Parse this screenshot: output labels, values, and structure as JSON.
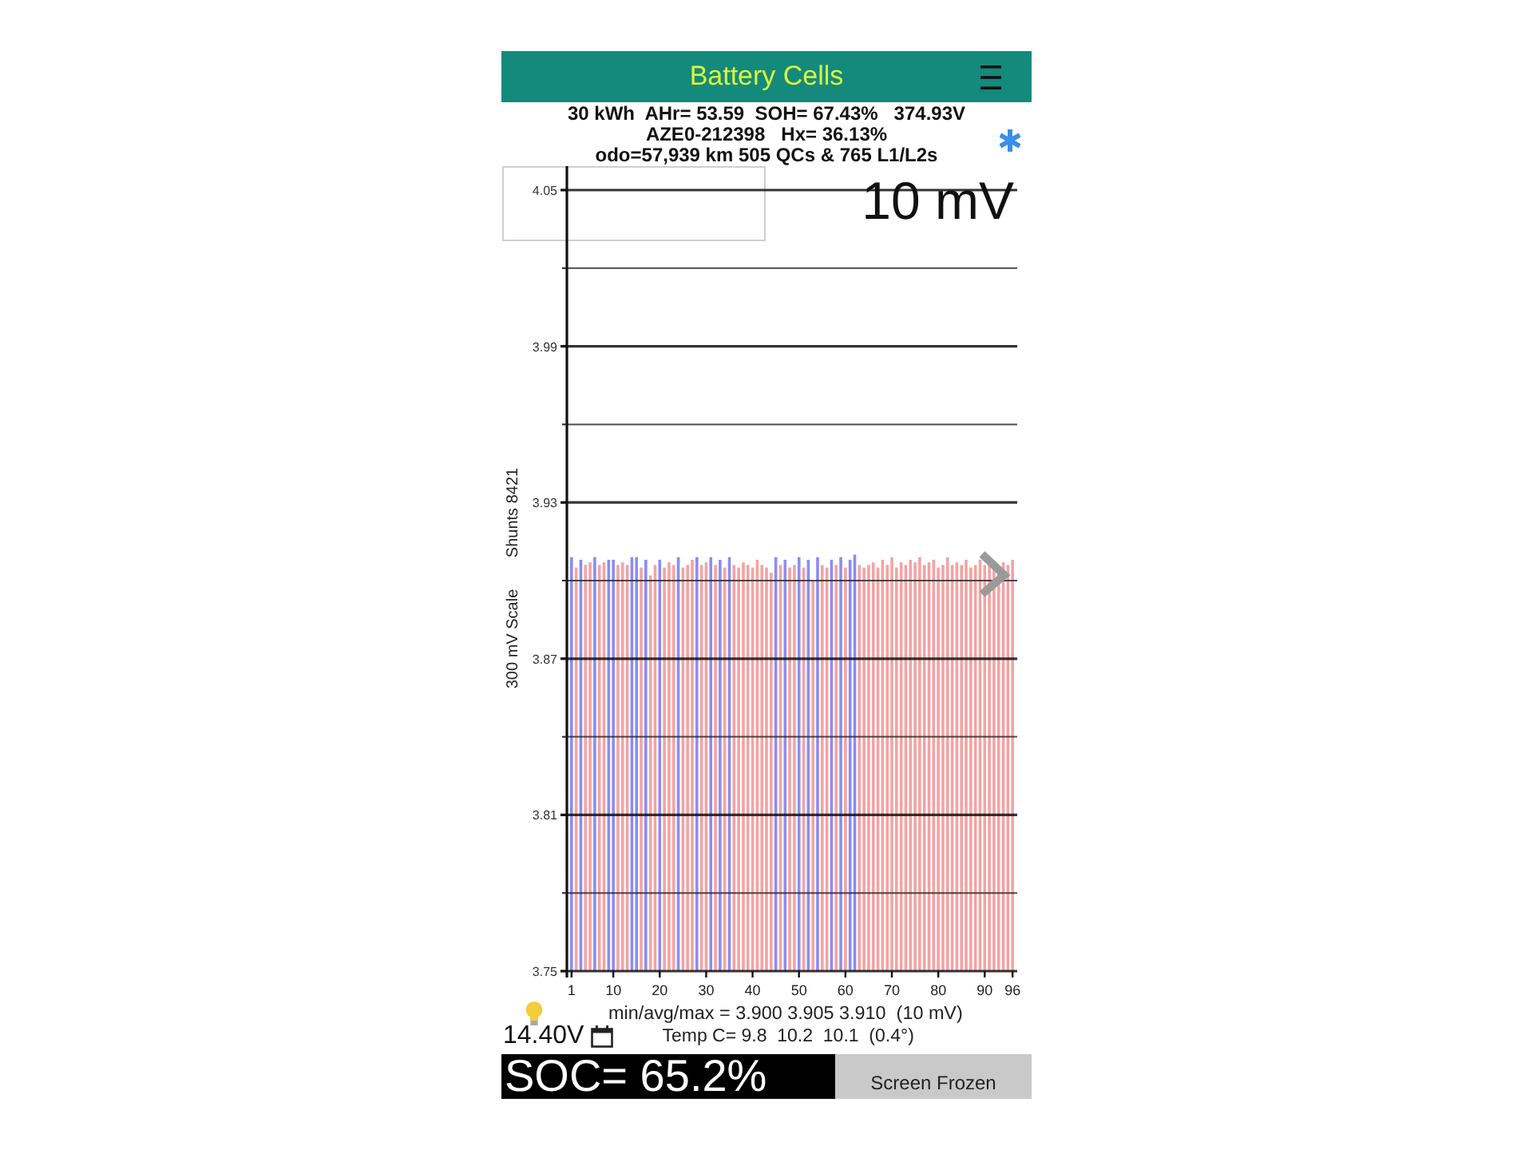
{
  "header": {
    "title": "Battery Cells"
  },
  "summary": {
    "lines": [
      "30 kWh  AHr= 53.59  SOH= 67.43%   374.93V",
      "AZE0-212398   Hx= 36.13%",
      "odo=57,939 km 505 QCs & 765 L1/L2s"
    ]
  },
  "cell_chart": {
    "scale_label": "10 mV",
    "shunts_label": "Shunts 8421",
    "chart_data": {
      "type": "bar",
      "ylabel": "300 mV Scale",
      "x": [
        1,
        2,
        3,
        4,
        5,
        6,
        7,
        8,
        9,
        10,
        11,
        12,
        13,
        14,
        15,
        16,
        17,
        18,
        19,
        20,
        21,
        22,
        23,
        24,
        25,
        26,
        27,
        28,
        29,
        30,
        31,
        32,
        33,
        34,
        35,
        36,
        37,
        38,
        39,
        40,
        41,
        42,
        43,
        44,
        45,
        46,
        47,
        48,
        49,
        50,
        51,
        52,
        53,
        54,
        55,
        56,
        57,
        58,
        59,
        60,
        61,
        62,
        63,
        64,
        65,
        66,
        67,
        68,
        69,
        70,
        71,
        72,
        73,
        74,
        75,
        76,
        77,
        78,
        79,
        80,
        81,
        82,
        83,
        84,
        85,
        86,
        87,
        88,
        89,
        90,
        91,
        92,
        93,
        94,
        95,
        96
      ],
      "series": [
        {
          "color": "#8c8cf2",
          "values": [
            3.909,
            null,
            3.908,
            null,
            null,
            3.909,
            null,
            null,
            3.908,
            3.908,
            null,
            null,
            null,
            3.909,
            3.909,
            null,
            3.908,
            null,
            null,
            3.908,
            null,
            null,
            null,
            3.909,
            null,
            null,
            null,
            3.909,
            null,
            null,
            3.909,
            null,
            3.908,
            null,
            3.909,
            null,
            null,
            null,
            null,
            null,
            null,
            null,
            null,
            null,
            3.909,
            null,
            3.908,
            null,
            null,
            3.909,
            null,
            3.908,
            null,
            3.909,
            null,
            null,
            3.908,
            null,
            3.909,
            null,
            3.908,
            3.91,
            null,
            null,
            null,
            null,
            null,
            null,
            null,
            null,
            null,
            null,
            null,
            null,
            null,
            null,
            null,
            null,
            null,
            null,
            null,
            null,
            null,
            null,
            null,
            null,
            null,
            null,
            null,
            null,
            null,
            null,
            null,
            null,
            null,
            null
          ]
        },
        {
          "color": "#f4a3a3",
          "values": [
            null,
            3.905,
            null,
            3.906,
            3.907,
            null,
            3.906,
            3.907,
            null,
            null,
            3.906,
            3.907,
            3.906,
            null,
            null,
            3.905,
            null,
            3.902,
            3.906,
            null,
            3.905,
            3.907,
            3.906,
            null,
            3.905,
            3.906,
            3.908,
            null,
            3.906,
            3.907,
            null,
            3.906,
            null,
            3.905,
            null,
            3.906,
            3.905,
            3.907,
            3.906,
            3.905,
            3.908,
            3.906,
            3.905,
            3.903,
            null,
            3.906,
            null,
            3.905,
            3.906,
            null,
            3.905,
            null,
            3.9,
            null,
            3.906,
            3.905,
            null,
            3.906,
            null,
            3.905,
            null,
            null,
            3.906,
            3.905,
            3.906,
            3.907,
            3.905,
            3.908,
            3.906,
            3.909,
            3.905,
            3.907,
            3.906,
            3.908,
            3.907,
            3.909,
            3.906,
            3.907,
            3.908,
            3.905,
            3.906,
            3.909,
            3.906,
            3.907,
            3.906,
            3.908,
            3.905,
            3.906,
            3.908,
            3.906,
            3.907,
            3.906,
            3.905,
            3.907,
            3.906,
            3.908
          ]
        }
      ],
      "xlim": [
        0,
        97
      ],
      "ylim": [
        3.75,
        4.05
      ],
      "xticks": [
        1,
        10,
        20,
        30,
        40,
        50,
        60,
        70,
        80,
        90,
        96
      ],
      "yticks": [
        3.75,
        3.81,
        3.87,
        3.93,
        3.99,
        4.05
      ],
      "grid": true
    }
  },
  "stats": {
    "min_avg_max": "min/avg/max = 3.900 3.905 3.910  (10 mV)",
    "aux_voltage": "14.40V",
    "temperature": "Temp C= 9.8  10.2  10.1  (0.4°)"
  },
  "soc": "SOC= 65.2%",
  "buttons": [
    {
      "label": "Screen Frozen"
    }
  ]
}
